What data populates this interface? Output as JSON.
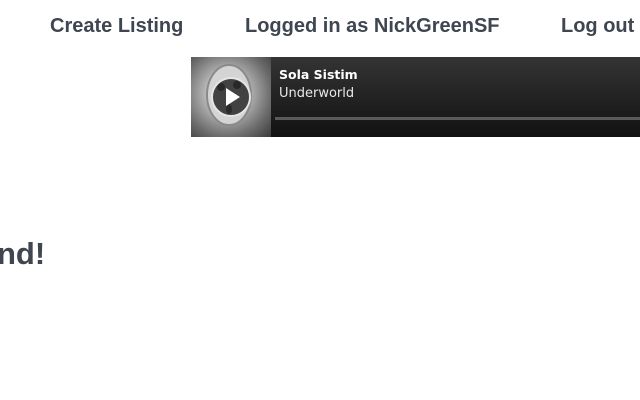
{
  "nav": {
    "create_listing": "Create Listing",
    "logged_in": "Logged in as NickGreenSF",
    "logout": "Log out"
  },
  "player": {
    "title": "Sola Sistim",
    "artist": "Underworld",
    "progress": 0,
    "artwork_icon": "face-artwork-icon",
    "play_icon": "play-icon"
  },
  "page": {
    "heading_partial": "nd!"
  },
  "colors": {
    "text": "#3f4651",
    "player_bg": "#2a2a2a"
  }
}
